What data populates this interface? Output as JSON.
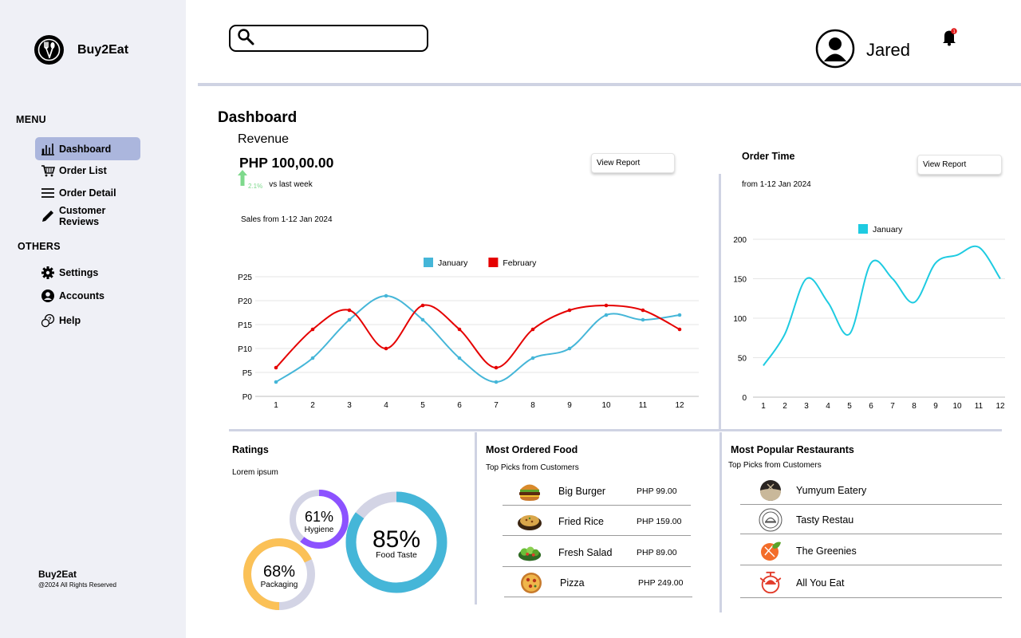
{
  "app": {
    "name": "Buy2Eat"
  },
  "sidebar": {
    "menu_label": "MENU",
    "menu_items": [
      {
        "label": "Dashboard",
        "icon": "bar-chart-icon",
        "active": true
      },
      {
        "label": "Order List",
        "icon": "cart-icon"
      },
      {
        "label": "Order Detail",
        "icon": "list-icon"
      },
      {
        "label": "Customer Reviews",
        "icon": "pencil-icon"
      }
    ],
    "others_label": "OTHERS",
    "other_items": [
      {
        "label": "Settings",
        "icon": "gear-icon"
      },
      {
        "label": "Accounts",
        "icon": "user-circle-icon"
      },
      {
        "label": "Help",
        "icon": "help-icon"
      }
    ],
    "footer_name": "Buy2Eat",
    "footer_copy": "@2024 All Rights Reserved"
  },
  "header": {
    "search_placeholder": "",
    "user_name": "Jared",
    "notification_count": "1"
  },
  "dashboard": {
    "title": "Dashboard",
    "revenue": {
      "label": "Revenue",
      "value": "PHP 100,00.00",
      "change_pct": "2.1%",
      "change_text": "vs last week",
      "subtitle": "Sales from 1-12 Jan 2024",
      "view_report": "View Report"
    },
    "order_time": {
      "title": "Order Time",
      "subtitle": "from 1-12 Jan 2024",
      "view_report": "View Report"
    },
    "ratings": {
      "title": "Ratings",
      "subtitle": "Lorem ipsum",
      "items": [
        {
          "pct_label": "61%",
          "name": "Hygiene",
          "value": 0.61,
          "color": "#8c52ff"
        },
        {
          "pct_label": "85%",
          "name": "Food Taste",
          "value": 0.85,
          "color": "#45b6d8"
        },
        {
          "pct_label": "68%",
          "name": "Packaging",
          "value": 0.68,
          "color": "#fbc157"
        }
      ]
    },
    "most_ordered": {
      "title": "Most Ordered Food",
      "subtitle": "Top Picks from Customers",
      "items": [
        {
          "name": "Big Burger",
          "price": "PHP 99.00",
          "icon": "burger-icon"
        },
        {
          "name": "Fried Rice",
          "price": "PHP 159.00",
          "icon": "fried-rice-icon"
        },
        {
          "name": "Fresh Salad",
          "price": "PHP 89.00",
          "icon": "salad-icon"
        },
        {
          "name": "Pizza",
          "price": "PHP 249.00",
          "icon": "pizza-icon"
        }
      ]
    },
    "popular_restaurants": {
      "title": "Most Popular Restaurants",
      "subtitle": "Top Picks from Customers",
      "items": [
        {
          "name": "Yumyum Eatery",
          "icon": "yumyum-logo-icon"
        },
        {
          "name": "Tasty Restau",
          "icon": "tasty-logo-icon"
        },
        {
          "name": "The Greenies",
          "icon": "greenies-logo-icon"
        },
        {
          "name": "All You Eat",
          "icon": "allyoueat-logo-icon"
        }
      ]
    }
  },
  "chart_data": [
    {
      "type": "line",
      "x": [
        1,
        2,
        3,
        4,
        5,
        6,
        7,
        8,
        9,
        10,
        11,
        12
      ],
      "y_ticks": [
        "P0",
        "P5",
        "P10",
        "P15",
        "P20",
        "P25"
      ],
      "ylim": [
        0,
        25
      ],
      "grid": true,
      "legend_position": "top-center",
      "series": [
        {
          "name": "January",
          "color": "#45b6d8",
          "values": [
            3,
            8,
            16,
            21,
            16,
            8,
            3,
            8,
            10,
            17,
            16,
            17
          ]
        },
        {
          "name": "February",
          "color": "#e50000",
          "values": [
            6,
            14,
            18,
            10,
            19,
            14,
            6,
            14,
            18,
            19,
            18,
            14
          ]
        }
      ]
    },
    {
      "type": "line",
      "x": [
        1,
        2,
        3,
        4,
        5,
        6,
        7,
        8,
        9,
        10,
        11,
        12
      ],
      "y_ticks": [
        "0",
        "50",
        "100",
        "150",
        "200"
      ],
      "ylim": [
        0,
        200
      ],
      "grid": true,
      "legend_position": "top-center",
      "series": [
        {
          "name": "January",
          "color": "#1ecbe1",
          "values": [
            40,
            80,
            150,
            120,
            80,
            170,
            150,
            120,
            170,
            180,
            190,
            150
          ]
        }
      ]
    }
  ]
}
